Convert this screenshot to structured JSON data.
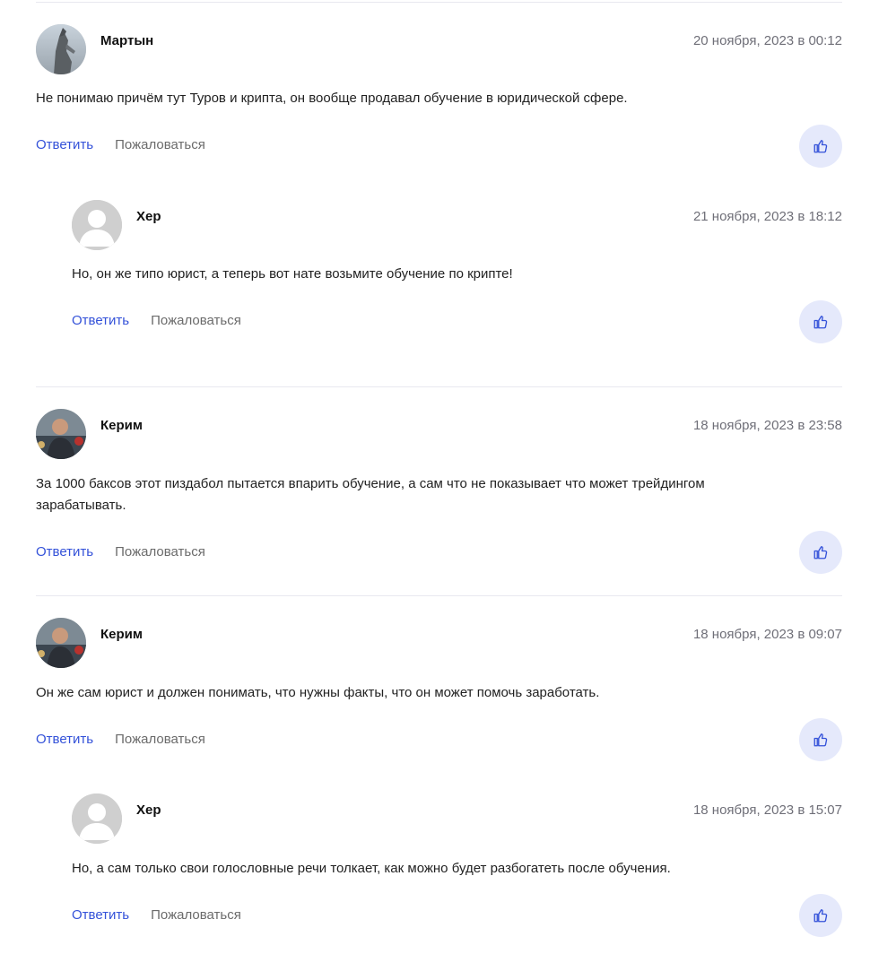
{
  "actions": {
    "reply_label": "Ответить",
    "report_label": "Пожаловаться"
  },
  "colors": {
    "accent": "#3452d9",
    "like_bg": "#e5e9fb",
    "divider": "#e8e8ef"
  },
  "comments": [
    {
      "author": "Мартын",
      "date": "20 ноября, 2023 в 00:12",
      "text": "Не понимаю причём тут Туров и крипта, он вообще продавал обучение в юридической сфере.",
      "avatar": "photo-statue-avatar",
      "replies": [
        {
          "author": "Хер",
          "date": "21 ноября, 2023 в 18:12",
          "text": "Но, он же типо юрист, а теперь вот нате возьмите обучение по крипте!",
          "avatar": "default-user-avatar"
        }
      ]
    },
    {
      "author": "Керим",
      "date": "18 ноября, 2023 в 23:58",
      "text": "За 1000 баксов этот пиздабол пытается впарить обучение, а сам что не показывает что может трейдингом зарабатывать.",
      "avatar": "photo-person-avatar",
      "replies": []
    },
    {
      "author": "Керим",
      "date": "18 ноября, 2023 в 09:07",
      "text": "Он же сам юрист и должен понимать, что нужны факты, что он может помочь заработать.",
      "avatar": "photo-person-avatar",
      "replies": [
        {
          "author": "Хер",
          "date": "18 ноября, 2023 в 15:07",
          "text": "Но, а сам только свои голословные речи толкает, как можно будет разбогатеть после обучения.",
          "avatar": "default-user-avatar"
        }
      ]
    }
  ]
}
